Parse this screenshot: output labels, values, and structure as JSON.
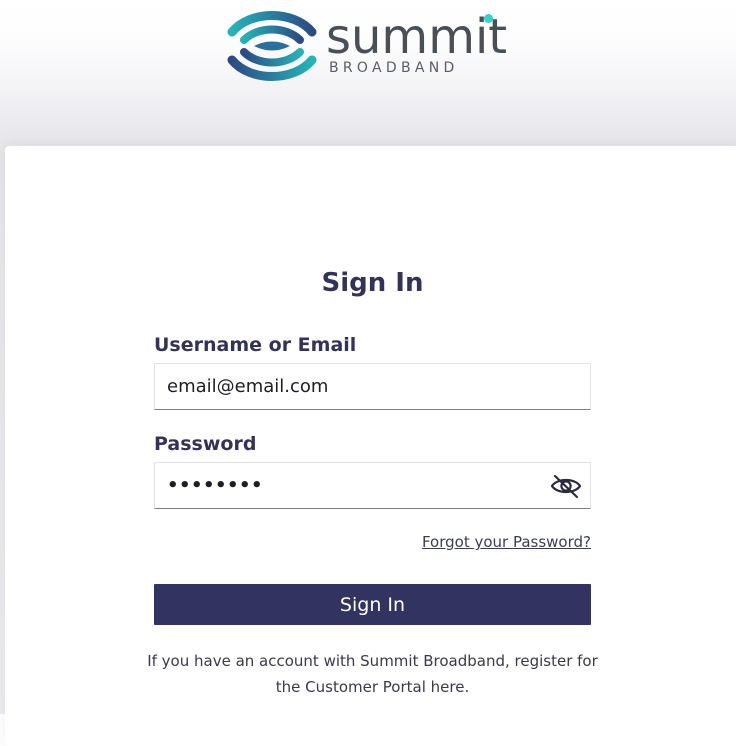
{
  "brand": {
    "name": "summit",
    "subtitle": "BROADBAND",
    "colors": {
      "mark_teal": "#1fa5b0",
      "mark_navy": "#2e4f86",
      "dot": "#2fd3cf",
      "wordmark": "#4a4e55"
    }
  },
  "form": {
    "title": "Sign In",
    "username_label": "Username or Email",
    "username_value": "email@email.com",
    "password_label": "Password",
    "password_value": "••••••••",
    "password_toggle_icon": "eye-slash-icon",
    "forgot_link": "Forgot your Password?",
    "submit_label": "Sign In",
    "register_text_line1": "If you have an account with Summit Broadband, register for",
    "register_text_line2": "the Customer Portal here."
  },
  "colors": {
    "primary": "#333361",
    "heading": "#33335a"
  }
}
